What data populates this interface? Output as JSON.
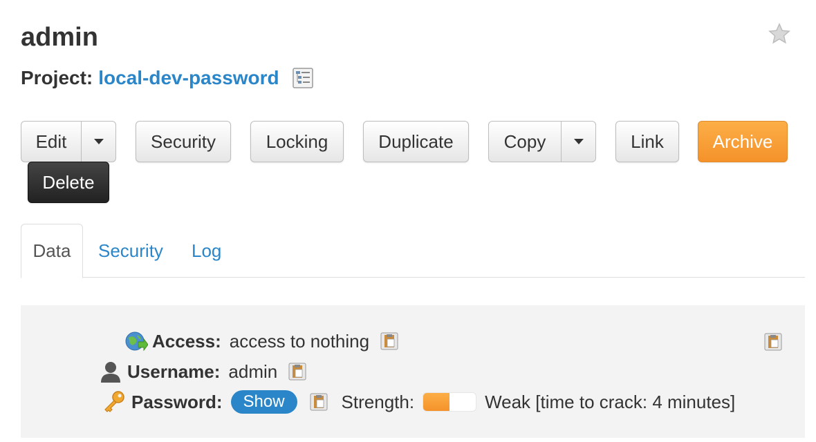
{
  "page": {
    "title": "admin",
    "project_label": "Project:",
    "project_name": "local-dev-password"
  },
  "toolbar": {
    "edit_label": "Edit",
    "security_label": "Security",
    "locking_label": "Locking",
    "duplicate_label": "Duplicate",
    "copy_label": "Copy",
    "link_label": "Link",
    "archive_label": "Archive",
    "delete_label": "Delete"
  },
  "tabs": [
    {
      "label": "Data",
      "active": true
    },
    {
      "label": "Security",
      "active": false
    },
    {
      "label": "Log",
      "active": false
    }
  ],
  "fields": {
    "access": {
      "label": "Access:",
      "value": "access to nothing",
      "icon": "globe-arrow-icon"
    },
    "username": {
      "label": "Username:",
      "value": "admin",
      "icon": "user-icon"
    },
    "password": {
      "label": "Password:",
      "show_label": "Show",
      "icon": "key-icon",
      "strength_label": "Strength:",
      "strength_text": "Weak [time to crack: 4 minutes]",
      "strength_level": 0.5
    }
  },
  "colors": {
    "accent": "#2a86c8",
    "archive": "#f5922a",
    "delete": "#2b2b2b",
    "panel": "#f3f3f3"
  }
}
